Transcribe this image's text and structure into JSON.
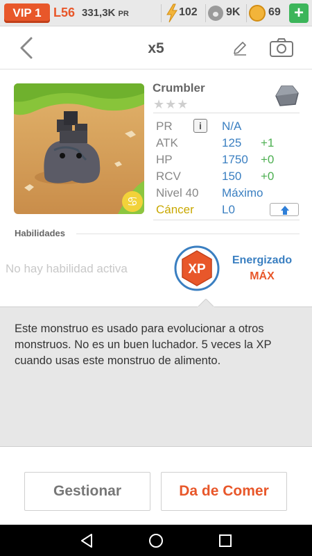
{
  "status_bar": {
    "vip": "VIP 1",
    "level": "L56",
    "pr_value": "331,3K",
    "pr_unit": "PR",
    "energy": "102",
    "paw_points": "9K",
    "coins": "69",
    "plus": "+"
  },
  "header": {
    "title": "x5"
  },
  "monster": {
    "name": "Crumbler",
    "stars": "★★★",
    "stats": [
      {
        "label": "PR",
        "value": "N/A",
        "bonus": ""
      },
      {
        "label": "ATK",
        "value": "125",
        "bonus": "+1"
      },
      {
        "label": "HP",
        "value": "1750",
        "bonus": "+0"
      },
      {
        "label": "RCV",
        "value": "150",
        "bonus": "+0"
      },
      {
        "label": "Nivel 40",
        "value": "Máximo",
        "bonus": ""
      },
      {
        "label": "Cáncer",
        "value": "L0",
        "bonus": ""
      }
    ],
    "info_icon": "i"
  },
  "skills": {
    "title": "Habilidades",
    "empty_text": "No hay habilidad activa",
    "badge": "XP",
    "energized": "Energizado",
    "max": "MÁX"
  },
  "description": "Este monstruo es usado para evolucionar a otros monstruos. No es un buen luchador. 5 veces la XP cuando usas este monstruo de alimento.",
  "buttons": {
    "manage": "Gestionar",
    "feed": "Da de Comer"
  },
  "colors": {
    "accent": "#e8572a",
    "stat_value": "#3a7fc1",
    "stat_bonus": "#4caf50"
  }
}
